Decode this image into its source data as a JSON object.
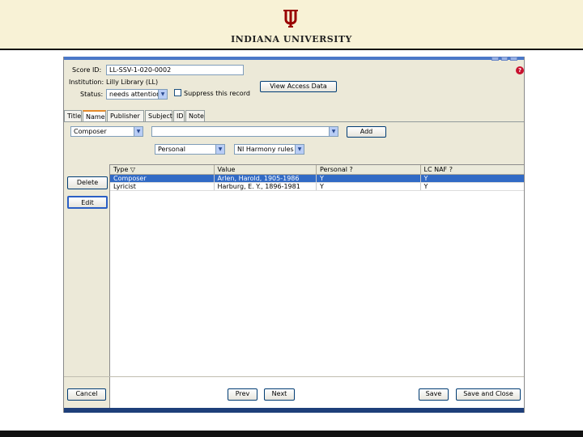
{
  "banner": {
    "university": "INDIANA UNIVERSITY",
    "logo_icon": "iu-trident-icon",
    "accent": "#990000"
  },
  "form": {
    "score_id_label": "Score ID:",
    "score_id_value": "LL-SSV-1-020-0002",
    "institution_label": "Institution:",
    "institution_value": "Lilly Library (LL)",
    "status_label": "Status:",
    "status_value": "needs attention",
    "suppress_label": "Suppress this record",
    "view_access_label": "View Access Data"
  },
  "tabs": [
    {
      "label": "Title"
    },
    {
      "label": "Name"
    },
    {
      "label": "Publisher"
    },
    {
      "label": "Subject"
    },
    {
      "label": "ID"
    },
    {
      "label": "Note"
    }
  ],
  "name_tab": {
    "role_value": "Composer",
    "name_value": "",
    "add_label": "Add",
    "type_value": "Personal",
    "rules_value": "NI Harmony rules"
  },
  "actions": {
    "delete_label": "Delete",
    "edit_label": "Edit"
  },
  "table": {
    "headers": [
      "Type ▽",
      "Value",
      "Personal ?",
      "LC NAF ?"
    ],
    "rows": [
      [
        "Composer",
        "Arlen, Harold, 1905-1986",
        "Y",
        "Y"
      ],
      [
        "Lyricist",
        "Harburg, E. Y., 1896-1981",
        "Y",
        "Y"
      ]
    ]
  },
  "footer": {
    "cancel_label": "Cancel",
    "prev_label": "Prev",
    "next_label": "Next",
    "save_label": "Save",
    "save_close_label": "Save and Close"
  },
  "colors": {
    "selection": "#316ac5",
    "window": "#ece9d8",
    "banner": "#f8f2d6"
  }
}
